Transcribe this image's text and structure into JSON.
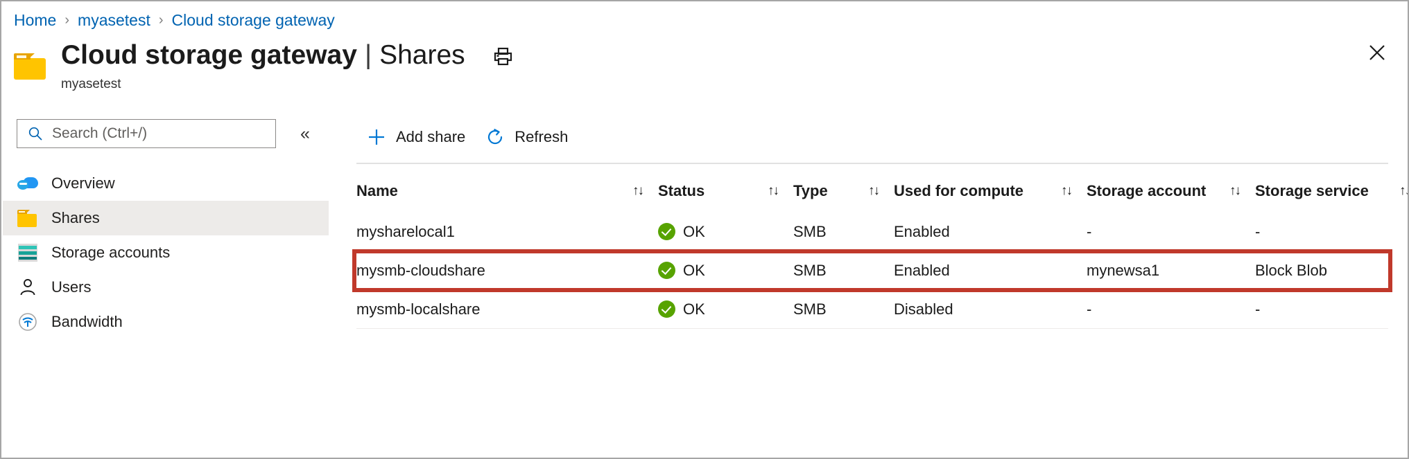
{
  "breadcrumb": {
    "items": [
      {
        "label": "Home"
      },
      {
        "label": "myasetest"
      },
      {
        "label": "Cloud storage gateway"
      }
    ],
    "separator": "›"
  },
  "header": {
    "title": "Cloud storage gateway",
    "title_separator": "|",
    "title_section": "Shares",
    "subtitle": "myasetest",
    "print_icon": "print-icon",
    "close_icon": "close-icon",
    "folder_icon": "folder-icon"
  },
  "sidebar": {
    "search": {
      "placeholder": "Search (Ctrl+/)",
      "value": "",
      "icon": "search-icon"
    },
    "collapse": {
      "icon": "chevron-double-left-icon",
      "glyph": "«"
    },
    "items": [
      {
        "label": "Overview",
        "icon": "cloud-icon",
        "selected": false
      },
      {
        "label": "Shares",
        "icon": "folder-icon",
        "selected": true
      },
      {
        "label": "Storage accounts",
        "icon": "storage-account-icon",
        "selected": false
      },
      {
        "label": "Users",
        "icon": "person-icon",
        "selected": false
      },
      {
        "label": "Bandwidth",
        "icon": "bandwidth-icon",
        "selected": false
      }
    ]
  },
  "toolbar": {
    "add_share_label": "Add share",
    "add_share_icon": "plus-icon",
    "refresh_label": "Refresh",
    "refresh_icon": "refresh-icon"
  },
  "table": {
    "columns": [
      {
        "key": "name",
        "label": "Name",
        "sortable": true
      },
      {
        "key": "status",
        "label": "Status",
        "sortable": true
      },
      {
        "key": "type",
        "label": "Type",
        "sortable": true
      },
      {
        "key": "compute",
        "label": "Used for compute",
        "sortable": true
      },
      {
        "key": "account",
        "label": "Storage account",
        "sortable": true
      },
      {
        "key": "service",
        "label": "Storage service",
        "sortable": true
      }
    ],
    "sort_glyph": "↑↓",
    "menu_glyph": "•••",
    "rows": [
      {
        "name": "mysharelocal1",
        "status": "OK",
        "type": "SMB",
        "compute": "Enabled",
        "account": "-",
        "service": "-",
        "highlighted": false
      },
      {
        "name": "mysmb-cloudshare",
        "status": "OK",
        "type": "SMB",
        "compute": "Enabled",
        "account": "mynewsa1",
        "service": "Block Blob",
        "highlighted": true
      },
      {
        "name": "mysmb-localshare",
        "status": "OK",
        "type": "SMB",
        "compute": "Disabled",
        "account": "-",
        "service": "-",
        "highlighted": false
      }
    ]
  },
  "colors": {
    "link": "#0063b1",
    "accent": "#0078d4",
    "status_ok": "#57a300",
    "highlight_border": "#c0392b",
    "selected_row_bg": "#edebe9",
    "folder_yellow": "#ffc400"
  }
}
